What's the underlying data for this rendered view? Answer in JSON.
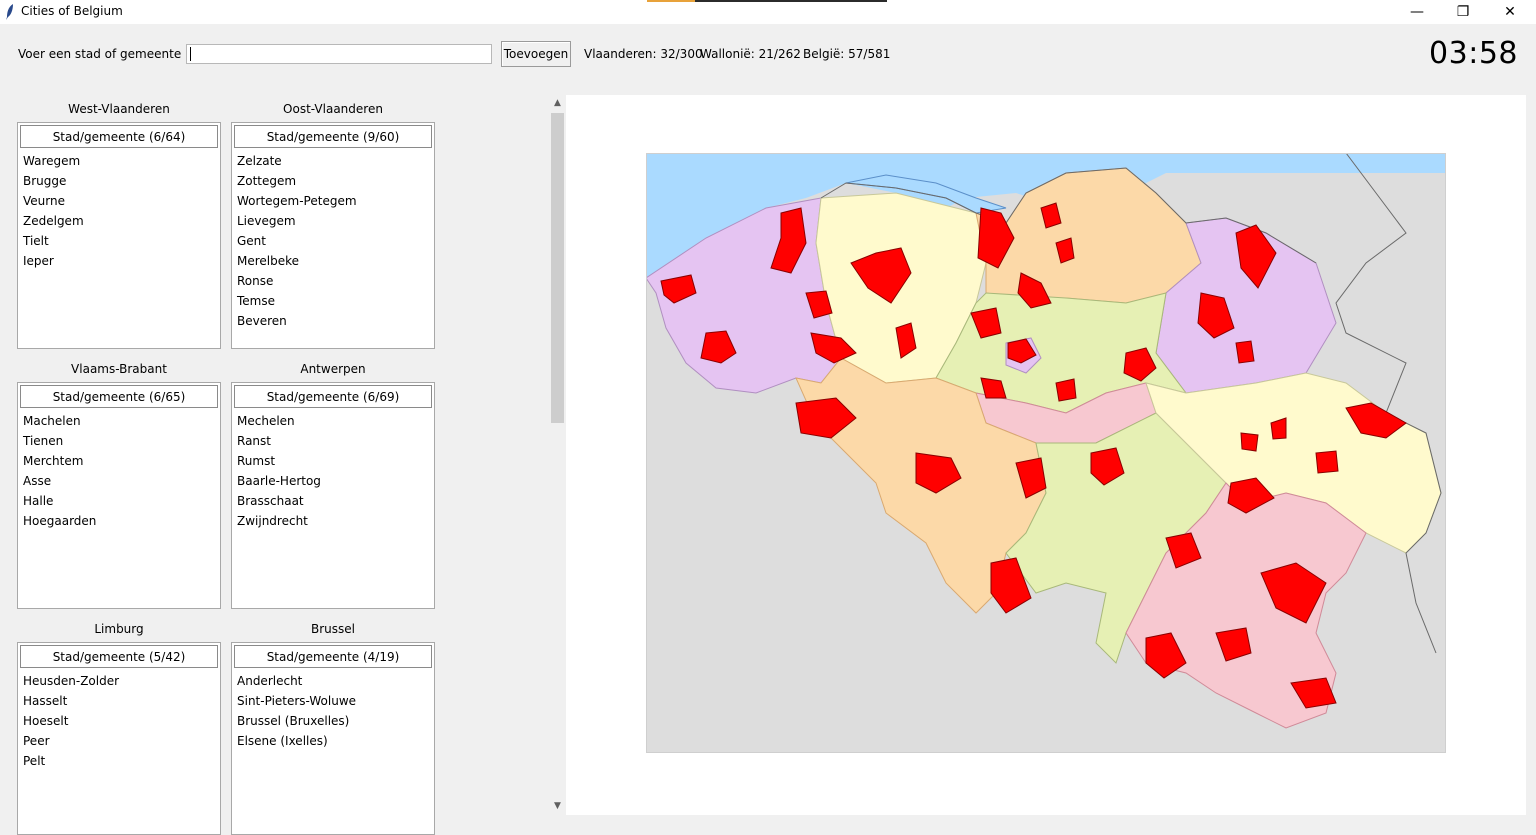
{
  "window": {
    "title": "Cities of Belgium",
    "minimize_glyph": "—",
    "restore_glyph": "❐",
    "close_glyph": "✕"
  },
  "input": {
    "label": "Voer een stad of gemeente in:",
    "value": "",
    "placeholder": ""
  },
  "add_button": "Toevoegen",
  "stats": {
    "flanders": "Vlaanderen: 32/300",
    "wallonia": "Wallonië: 21/262",
    "belgium": "België: 57/581"
  },
  "timer": "03:58",
  "provinces": [
    {
      "name": "West-Vlaanderen",
      "header": "Stad/gemeente (6/64)",
      "cities": [
        "Waregem",
        "Brugge",
        "Veurne",
        "Zedelgem",
        "Tielt",
        "Ieper"
      ]
    },
    {
      "name": "Oost-Vlaanderen",
      "header": "Stad/gemeente (9/60)",
      "cities": [
        "Zelzate",
        "Zottegem",
        "Wortegem-Petegem",
        "Lievegem",
        "Gent",
        "Merelbeke",
        "Ronse",
        "Temse",
        "Beveren"
      ]
    },
    {
      "name": "Vlaams-Brabant",
      "header": "Stad/gemeente (6/65)",
      "cities": [
        "Machelen",
        "Tienen",
        "Merchtem",
        "Asse",
        "Halle",
        "Hoegaarden"
      ]
    },
    {
      "name": "Antwerpen",
      "header": "Stad/gemeente (6/69)",
      "cities": [
        "Mechelen",
        "Ranst",
        "Rumst",
        "Baarle-Hertog",
        "Brasschaat",
        "Zwijndrecht"
      ]
    },
    {
      "name": "Limburg",
      "header": "Stad/gemeente (5/42)",
      "cities": [
        "Heusden-Zolder",
        "Hasselt",
        "Hoeselt",
        "Peer",
        "Pelt"
      ]
    },
    {
      "name": "Brussel",
      "header": "Stad/gemeente (4/19)",
      "cities": [
        "Anderlecht",
        "Sint-Pieters-Woluwe",
        "Brussel (Bruxelles)",
        "Elsene (Ixelles)"
      ]
    }
  ],
  "map": {
    "colors": {
      "sea": "#aadaff",
      "land_outside": "#dddddd",
      "west_vlaanderen": "#e5c4f2",
      "oost_vlaanderen": "#fffacd",
      "antwerpen": "#fcd9a8",
      "limburg": "#e5c4f2",
      "vlaams_brabant": "#e6f0b4",
      "brussel": "#e5c4f2",
      "hainaut": "#fcd9a8",
      "brabant_wallon": "#f7c8d0",
      "namur": "#e6f0b4",
      "liege": "#fffacd",
      "luxembourg": "#f7c8d0",
      "found_city": "#ff0000"
    }
  }
}
